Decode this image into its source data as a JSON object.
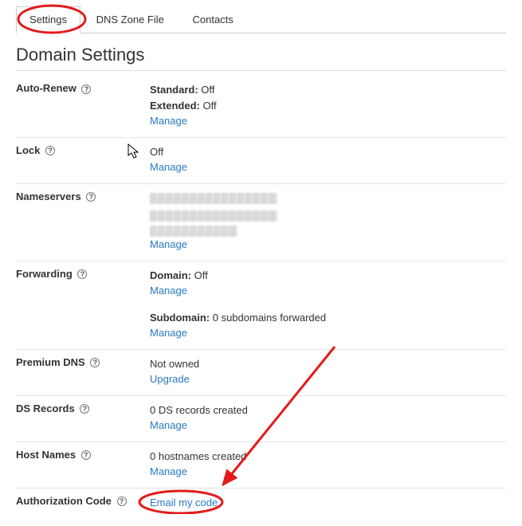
{
  "tabs": [
    {
      "label": "Settings",
      "active": true
    },
    {
      "label": "DNS Zone File",
      "active": false
    },
    {
      "label": "Contacts",
      "active": false
    }
  ],
  "heading": "Domain Settings",
  "help_glyph": "?",
  "rows": {
    "auto_renew": {
      "label": "Auto-Renew",
      "standard_label": "Standard:",
      "standard_value": "Off",
      "extended_label": "Extended:",
      "extended_value": "Off",
      "manage": "Manage"
    },
    "lock": {
      "label": "Lock",
      "value": "Off",
      "manage": "Manage"
    },
    "nameservers": {
      "label": "Nameservers",
      "manage": "Manage"
    },
    "forwarding": {
      "label": "Forwarding",
      "domain_label": "Domain:",
      "domain_value": "Off",
      "domain_manage": "Manage",
      "subdomain_label": "Subdomain:",
      "subdomain_value": "0 subdomains forwarded",
      "subdomain_manage": "Manage"
    },
    "premium_dns": {
      "label": "Premium DNS",
      "value": "Not owned",
      "upgrade": "Upgrade"
    },
    "ds_records": {
      "label": "DS Records",
      "value": "0 DS records created",
      "manage": "Manage"
    },
    "host_names": {
      "label": "Host Names",
      "value": "0 hostnames created",
      "manage": "Manage"
    },
    "auth_code": {
      "label": "Authorization Code",
      "email": "Email my code"
    }
  }
}
